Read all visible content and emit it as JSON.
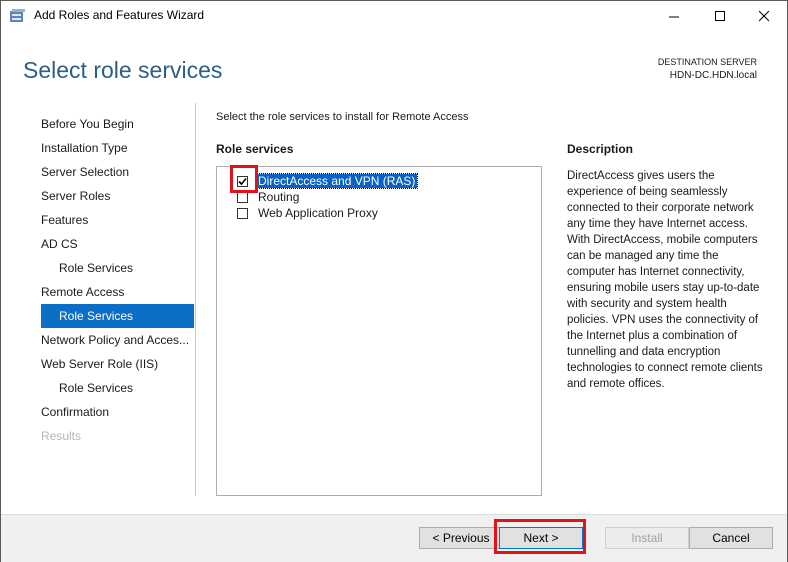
{
  "window": {
    "title": "Add Roles and Features Wizard",
    "minimize": "—",
    "maximize": "☐",
    "close": "✕"
  },
  "header": {
    "page_title": "Select role services",
    "destination_label": "DESTINATION SERVER",
    "destination_server": "HDN-DC.HDN.local"
  },
  "nav": {
    "items": [
      {
        "label": "Before You Begin",
        "state": "normal"
      },
      {
        "label": "Installation Type",
        "state": "normal"
      },
      {
        "label": "Server Selection",
        "state": "normal"
      },
      {
        "label": "Server Roles",
        "state": "normal"
      },
      {
        "label": "Features",
        "state": "normal"
      },
      {
        "label": "AD CS",
        "state": "normal"
      },
      {
        "label": "Role Services",
        "state": "sub"
      },
      {
        "label": "Remote Access",
        "state": "normal"
      },
      {
        "label": "Role Services",
        "state": "active"
      },
      {
        "label": "Network Policy and Acces...",
        "state": "normal"
      },
      {
        "label": "Web Server Role (IIS)",
        "state": "normal"
      },
      {
        "label": "Role Services",
        "state": "sub"
      },
      {
        "label": "Confirmation",
        "state": "normal"
      },
      {
        "label": "Results",
        "state": "disabled"
      }
    ]
  },
  "content": {
    "instruction": "Select the role services to install for Remote Access",
    "role_services_heading": "Role services",
    "description_heading": "Description",
    "role_services": [
      {
        "label": "DirectAccess and VPN (RAS)",
        "checked": true,
        "selected": true
      },
      {
        "label": "Routing",
        "checked": false,
        "selected": false
      },
      {
        "label": "Web Application Proxy",
        "checked": false,
        "selected": false
      }
    ],
    "description": "DirectAccess gives users the experience of being seamlessly connected to their corporate network any time they have Internet access. With DirectAccess, mobile computers can be managed any time the computer has Internet connectivity, ensuring mobile users stay up-to-date with security and system health policies. VPN uses the connectivity of the Internet plus a combination of tunnelling and data encryption technologies to connect remote clients and remote offices."
  },
  "footer": {
    "previous": "< Previous",
    "next": "Next >",
    "install": "Install",
    "cancel": "Cancel"
  },
  "colors": {
    "title_accent": "#2b5f86",
    "nav_active": "#0b6fc6",
    "highlight_annotation": "#e0131b"
  }
}
